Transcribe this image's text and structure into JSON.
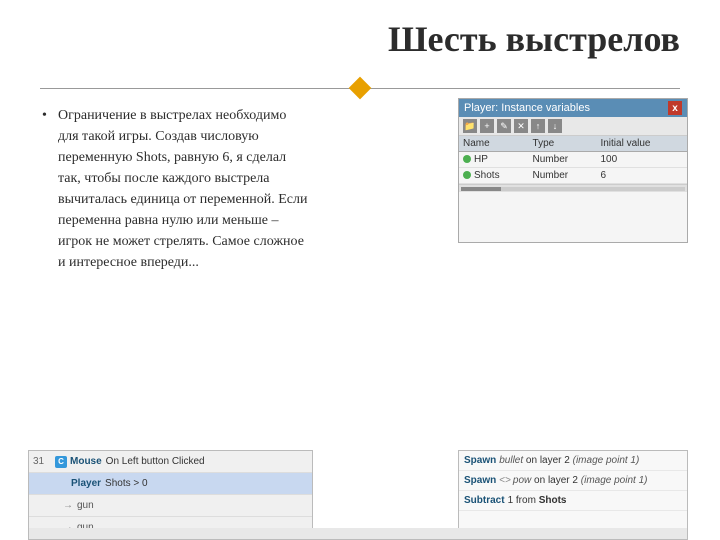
{
  "page": {
    "title": "Шесть выстрелов",
    "divider_diamond_color": "#e8a000"
  },
  "body_text": {
    "paragraph": "Ограничение в выстрелах необходимо для такой игры. Создав числовую переменную Shots, равную 6, я сделал так, чтобы после каждого выстрела вычиталась единица от переменной. Если переменна равна нулю или меньше – игрок не может стрелять. Самое сложное и интересное впереди..."
  },
  "instance_panel": {
    "title": "Player: Instance variables",
    "close_label": "x",
    "toolbar_icons": [
      "folder",
      "add",
      "edit",
      "delete",
      "up",
      "down"
    ],
    "columns": [
      "Name",
      "Type",
      "Initial value"
    ],
    "rows": [
      {
        "name": "HP",
        "type": "Number",
        "value": "100",
        "dot": "green"
      },
      {
        "name": "Shots",
        "type": "Number",
        "value": "6",
        "dot": "green"
      }
    ]
  },
  "event_panel_left": {
    "row_number": "31",
    "events": [
      {
        "object": "Mouse",
        "condition": "On Left button Clicked",
        "type": "C"
      },
      {
        "object": "Player",
        "condition": "Shots > 0"
      }
    ],
    "arrows": [
      "gun",
      "gun"
    ],
    "targets": [
      "gun",
      "gun"
    ]
  },
  "event_panel_right": {
    "actions": [
      {
        "keyword": "Spawn",
        "text": "bullet on layer 2 (image point 1)"
      },
      {
        "keyword": "Spawn",
        "compare": "<>",
        "text": "pow on layer 2 (image point 1)"
      },
      {
        "keyword": "Subtract",
        "text": "1 from Shots"
      }
    ]
  }
}
